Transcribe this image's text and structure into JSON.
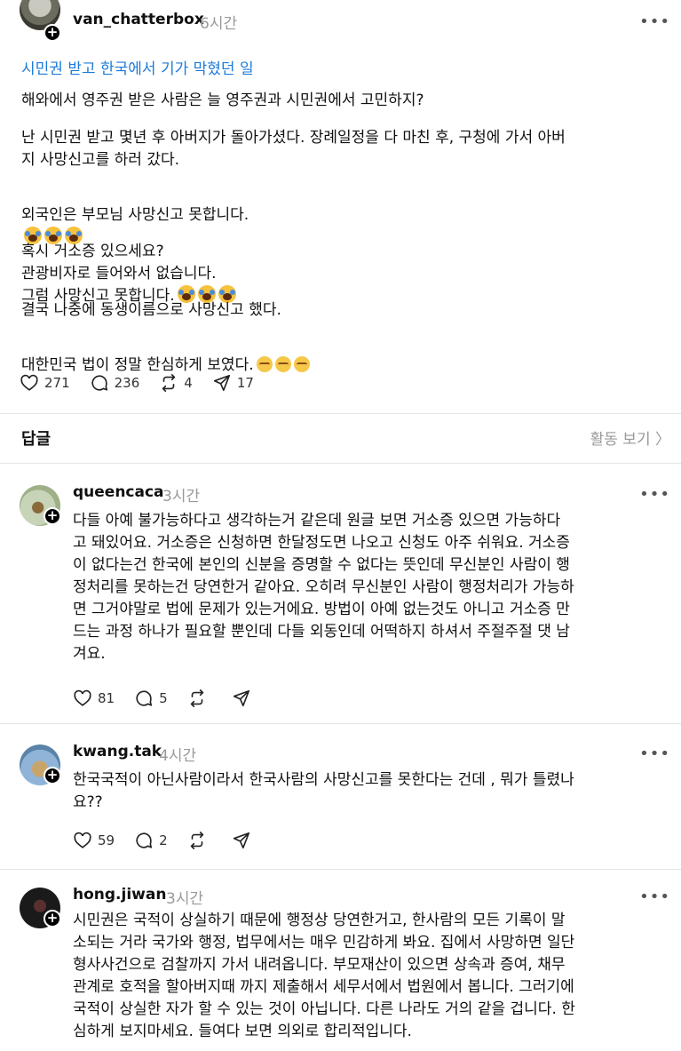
{
  "post": {
    "username": "van_chatterbox",
    "time": "6시간",
    "more": "•••",
    "link_title": "시민권 받고 한국에서 기가 막혔던 일",
    "paragraphs": [
      "해와에서 영주권 받은 사람은 늘 영주권과 시민권에서 고민하지?",
      "난 시민권 받고 몇년 후 아버지가 돌아가셨다. 장례일정을 다 마친 후, 구청에 가서 아버\n지 사망신고를 하러 갔다.",
      "외국인은 부모님 사망신고 못합니다.",
      "혹시 거소증 있으세요?\n관광비자로 들어와서 없습니다.\n그럼 사망신고 못합니다.",
      "결국 나중에 동생이름으로 사망신고 했다.",
      "대한민국 법이 정말 한심하게 보였다."
    ],
    "likes": "271",
    "comments": "236",
    "reposts": "4",
    "shares": "17"
  },
  "replies_header": {
    "title": "답글",
    "activity": "활동 보기 〉"
  },
  "replies": [
    {
      "username": "queencaca",
      "time": "3시간",
      "text": "다들 아예 불가능하다고 생각하는거 같은데 원글 보면 거소증 있으면 가능하다\n고 돼있어요. 거소증은 신청하면 한달정도면 나오고 신청도 아주 쉬워요. 거소증\n이 없다는건 한국에 본인의 신분을 증명할 수 없다는 뜻인데 무신분인 사람이 행\n정처리를 못하는건 당연한거 같아요. 오히려 무신분인 사람이 행정처리가 가능하\n면 그거야말로 법에 문제가 있는거에요. 방법이 아예 없는것도 아니고 거소증 만\n드는 과정 하나가 필요할 뿐인데 다들 외동인데 어떡하지 하셔서 주절주절 댓 남\n겨요.",
      "likes": "81",
      "comments": "5"
    },
    {
      "username": "kwang.tak",
      "time": "4시간",
      "text": "한국국적이 아닌사람이라서 한국사람의 사망신고를 못한다는 건데 , 뭐가 틀렸나\n요??",
      "likes": "59",
      "comments": "2"
    },
    {
      "username": "hong.jiwan",
      "time": "3시간",
      "text": "시민권은 국적이 상실하기 때문에 행정상 당연한거고, 한사람의 모든 기록이 말\n소되는 거라 국가와 행정, 법무에서는 매우 민감하게 봐요. 집에서 사망하면 일단\n형사사건으로 검찰까지 가서 내려옵니다. 부모재산이 있으면 상속과 증여, 채무\n관계로 호적을 할아버지때 까지 제출해서 세무서에서 법원에서 봅니다. 그러기에\n국적이 상실한 자가 할 수 있는 것이 아닙니다. 다른 나라도 거의 같을 겁니다. 한\n심하게 보지마세요. 들여다 보면 의외로 합리적입니다."
    }
  ],
  "icons": {
    "heart": "heart-icon",
    "comment": "comment-icon",
    "repost": "repost-icon",
    "share": "share-icon"
  },
  "colors": {
    "link": "#1d7bd8",
    "muted": "#999999",
    "divider": "#e5e5e5"
  }
}
